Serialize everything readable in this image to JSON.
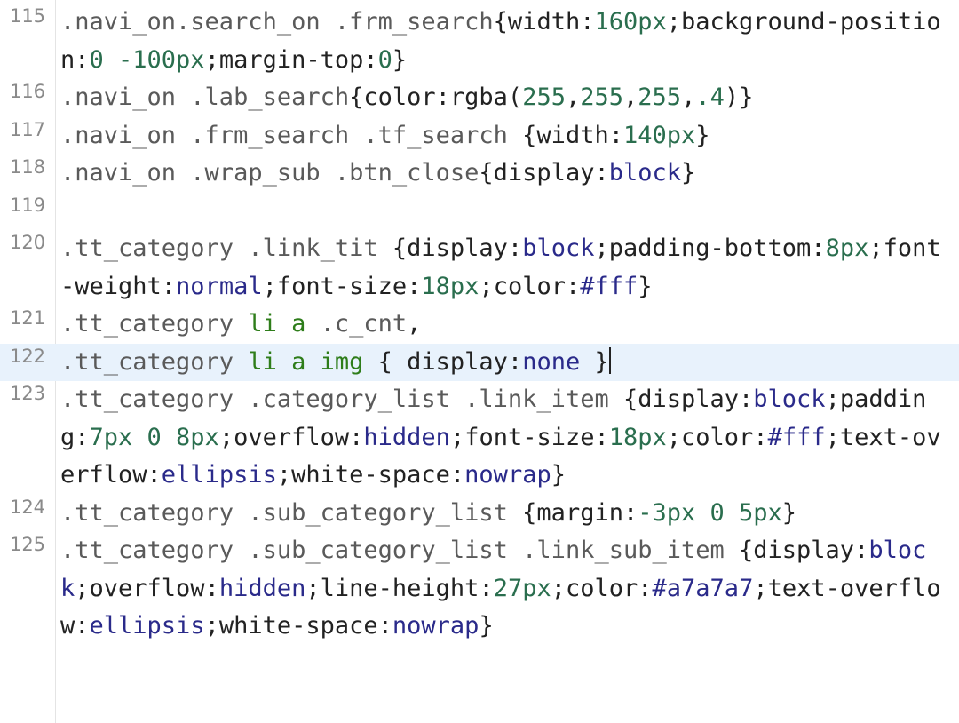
{
  "colors": {
    "selector": "#5a5a5a",
    "tag": "#2e7d1a",
    "property": "#222222",
    "punct": "#222222",
    "keyword": "#2a2a8a",
    "number": "#2a6e4e",
    "hexcolor": "#2a2a8a",
    "active_line_bg": "#e8f2fc"
  },
  "editor": {
    "active_line": "122",
    "lines": [
      {
        "num": "115",
        "tokens": [
          {
            "t": ".navi_on.search_on .frm_search",
            "c": "selector"
          },
          {
            "t": "{width:",
            "c": "punct"
          },
          {
            "t": "160px",
            "c": "number"
          },
          {
            "t": ";background-position:",
            "c": "punct"
          },
          {
            "t": "0 -100px",
            "c": "number"
          },
          {
            "t": ";margin-top:",
            "c": "punct"
          },
          {
            "t": "0",
            "c": "number"
          },
          {
            "t": "}",
            "c": "punct"
          }
        ]
      },
      {
        "num": "116",
        "tokens": [
          {
            "t": ".navi_on .lab_search",
            "c": "selector"
          },
          {
            "t": "{color:rgba(",
            "c": "punct"
          },
          {
            "t": "255",
            "c": "number"
          },
          {
            "t": ",",
            "c": "punct"
          },
          {
            "t": "255",
            "c": "number"
          },
          {
            "t": ",",
            "c": "punct"
          },
          {
            "t": "255",
            "c": "number"
          },
          {
            "t": ",",
            "c": "punct"
          },
          {
            "t": ".4",
            "c": "number"
          },
          {
            "t": ")}",
            "c": "punct"
          }
        ]
      },
      {
        "num": "117",
        "tokens": [
          {
            "t": ".navi_on .frm_search .tf_search ",
            "c": "selector"
          },
          {
            "t": "{width:",
            "c": "punct"
          },
          {
            "t": "140px",
            "c": "number"
          },
          {
            "t": "}",
            "c": "punct"
          }
        ]
      },
      {
        "num": "118",
        "tokens": [
          {
            "t": ".navi_on .wrap_sub .btn_close",
            "c": "selector"
          },
          {
            "t": "{display:",
            "c": "punct"
          },
          {
            "t": "block",
            "c": "keyword"
          },
          {
            "t": "}",
            "c": "punct"
          }
        ]
      },
      {
        "num": "119",
        "tokens": []
      },
      {
        "num": "120",
        "tokens": [
          {
            "t": ".tt_category .link_tit ",
            "c": "selector"
          },
          {
            "t": "{display:",
            "c": "punct"
          },
          {
            "t": "block",
            "c": "keyword"
          },
          {
            "t": ";padding-bottom:",
            "c": "punct"
          },
          {
            "t": "8px",
            "c": "number"
          },
          {
            "t": ";font-weight:",
            "c": "punct"
          },
          {
            "t": "normal",
            "c": "keyword"
          },
          {
            "t": ";font-size:",
            "c": "punct"
          },
          {
            "t": "18px",
            "c": "number"
          },
          {
            "t": ";color:",
            "c": "punct"
          },
          {
            "t": "#fff",
            "c": "hexcolor"
          },
          {
            "t": "}",
            "c": "punct"
          }
        ]
      },
      {
        "num": "121",
        "tokens": [
          {
            "t": ".tt_category ",
            "c": "selector"
          },
          {
            "t": "li a",
            "c": "tag"
          },
          {
            "t": " .c_cnt",
            "c": "selector"
          },
          {
            "t": ",",
            "c": "punct"
          }
        ]
      },
      {
        "num": "122",
        "tokens": [
          {
            "t": ".tt_category ",
            "c": "selector"
          },
          {
            "t": "li a img",
            "c": "tag"
          },
          {
            "t": " { display:",
            "c": "punct"
          },
          {
            "t": "none",
            "c": "keyword"
          },
          {
            "t": " }",
            "c": "punct"
          }
        ],
        "cursor": true
      },
      {
        "num": "123",
        "tokens": [
          {
            "t": ".tt_category .category_list .link_item",
            "c": "selector"
          },
          {
            "t": " {display:",
            "c": "punct"
          },
          {
            "t": "block",
            "c": "keyword"
          },
          {
            "t": ";padding:",
            "c": "punct"
          },
          {
            "t": "7px 0 8px",
            "c": "number"
          },
          {
            "t": ";overflow:",
            "c": "punct"
          },
          {
            "t": "hidden",
            "c": "keyword"
          },
          {
            "t": ";font-size:",
            "c": "punct"
          },
          {
            "t": "18px",
            "c": "number"
          },
          {
            "t": ";color:",
            "c": "punct"
          },
          {
            "t": "#fff",
            "c": "hexcolor"
          },
          {
            "t": ";text-overflow:",
            "c": "punct"
          },
          {
            "t": "ellipsis",
            "c": "keyword"
          },
          {
            "t": ";white-space:",
            "c": "punct"
          },
          {
            "t": "nowrap",
            "c": "keyword"
          },
          {
            "t": "}",
            "c": "punct"
          }
        ]
      },
      {
        "num": "124",
        "tokens": [
          {
            "t": ".tt_category .sub_category_list ",
            "c": "selector"
          },
          {
            "t": "{margin:",
            "c": "punct"
          },
          {
            "t": "-3px 0 5px",
            "c": "number"
          },
          {
            "t": "}",
            "c": "punct"
          }
        ]
      },
      {
        "num": "125",
        "tokens": [
          {
            "t": ".tt_category .sub_category_list .link_sub_item",
            "c": "selector"
          },
          {
            "t": " {display:",
            "c": "punct"
          },
          {
            "t": "block",
            "c": "keyword"
          },
          {
            "t": ";overflow:",
            "c": "punct"
          },
          {
            "t": "hidden",
            "c": "keyword"
          },
          {
            "t": ";line-height:",
            "c": "punct"
          },
          {
            "t": "27px",
            "c": "number"
          },
          {
            "t": ";color:",
            "c": "punct"
          },
          {
            "t": "#a7a7a7",
            "c": "hexcolor"
          },
          {
            "t": ";text-overflow:",
            "c": "punct"
          },
          {
            "t": "ellipsis",
            "c": "keyword"
          },
          {
            "t": ";white-space:",
            "c": "punct"
          },
          {
            "t": "nowrap",
            "c": "keyword"
          },
          {
            "t": "}",
            "c": "punct"
          }
        ]
      }
    ]
  }
}
